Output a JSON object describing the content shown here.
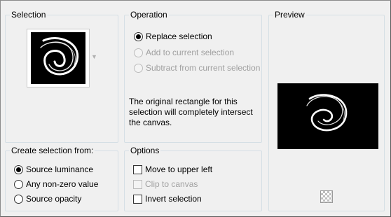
{
  "selection": {
    "title": "Selection"
  },
  "operation": {
    "title": "Operation",
    "options": [
      {
        "label": "Replace selection",
        "selected": true,
        "enabled": true
      },
      {
        "label": "Add to current selection",
        "selected": false,
        "enabled": false
      },
      {
        "label": "Subtract from current selection",
        "selected": false,
        "enabled": false
      }
    ],
    "note": "The original rectangle for this selection will completely intersect the canvas."
  },
  "preview": {
    "title": "Preview"
  },
  "create_from": {
    "title": "Create selection from:",
    "options": [
      {
        "label": "Source luminance",
        "selected": true
      },
      {
        "label": "Any non-zero value",
        "selected": false
      },
      {
        "label": "Source opacity",
        "selected": false
      }
    ]
  },
  "options": {
    "title": "Options",
    "items": [
      {
        "label": "Move to upper left",
        "checked": false,
        "enabled": true
      },
      {
        "label": "Clip to canvas",
        "checked": false,
        "enabled": false
      },
      {
        "label": "Invert selection",
        "checked": false,
        "enabled": true
      }
    ]
  },
  "colors": {
    "image_bg": "#000000",
    "swirl": "#ffffff",
    "group_border": "#d5dfe5"
  },
  "icons": {
    "dropdown": "chevron-down-icon",
    "transparency": "checkerboard-icon"
  }
}
